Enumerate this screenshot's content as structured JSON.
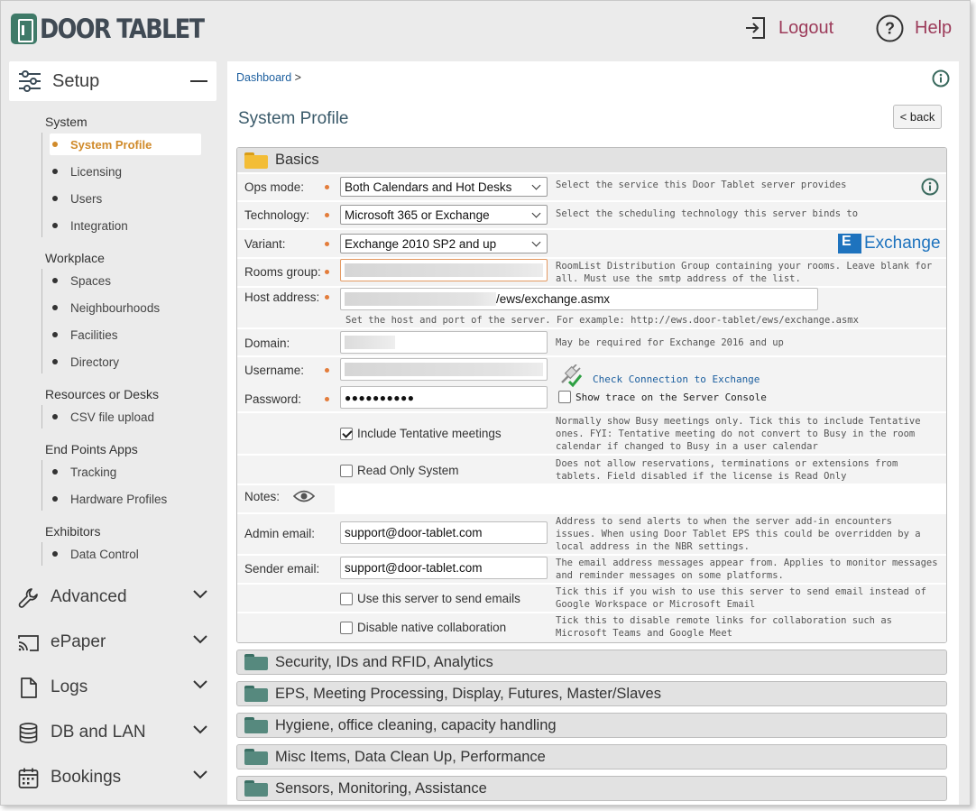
{
  "brand": {
    "logo_text": "DOOR TABLET"
  },
  "header": {
    "logout_label": "Logout",
    "help_label": "Help"
  },
  "sidebar": {
    "setup_label": "Setup",
    "groups": [
      {
        "title": "System",
        "items": [
          "System Profile",
          "Licensing",
          "Users",
          "Integration"
        ]
      },
      {
        "title": "Workplace",
        "items": [
          "Spaces",
          "Neighbourhoods",
          "Facilities",
          "Directory"
        ]
      },
      {
        "title": "Resources or Desks",
        "items": [
          "CSV file upload"
        ]
      },
      {
        "title": "End Points Apps",
        "items": [
          "Tracking",
          "Hardware Profiles"
        ]
      },
      {
        "title": "Exhibitors",
        "items": [
          "Data Control"
        ]
      }
    ],
    "active_item": "System Profile",
    "sections": [
      "Advanced",
      "ePaper",
      "Logs",
      "DB and LAN",
      "Bookings"
    ]
  },
  "main": {
    "breadcrumb": "Dashboard",
    "breadcrumb_sep": ">",
    "page_title": "System Profile",
    "back_label": "< back",
    "basics": {
      "title": "Basics",
      "ops_mode": {
        "label": "Ops mode:",
        "value": "Both Calendars and Hot Desks",
        "desc": "Select the service this Door Tablet server provides"
      },
      "technology": {
        "label": "Technology:",
        "value": "Microsoft 365 or Exchange",
        "desc": "Select the scheduling technology this server binds to"
      },
      "variant": {
        "label": "Variant:",
        "value": "Exchange 2010 SP2 and up",
        "brand": "Exchange"
      },
      "rooms_group": {
        "label": "Rooms group:",
        "desc1": "RoomList Distribution Group containing your rooms. Leave blank for",
        "desc2": "all.  Must use the smtp address of the list."
      },
      "host_address": {
        "label": "Host address:",
        "value_suffix": "/ews/exchange.asmx",
        "desc": "Set the host and port of the server. For example: http://ews.door-tablet/ews/exchange.asmx"
      },
      "domain": {
        "label": "Domain:",
        "desc": "May be required for Exchange 2016 and up"
      },
      "username": {
        "label": "Username:",
        "check_link": "Check Connection to Exchange"
      },
      "password": {
        "label": "Password:",
        "value": "●●●●●●●●●●",
        "trace_label": "Show trace on the Server Console"
      },
      "tentative": {
        "label": "Include Tentative meetings",
        "checked": true,
        "desc1": "Normally show Busy meetings only. Tick this to include Tentative",
        "desc2": "ones. FYI: Tentative meeting do not convert to Busy in the room",
        "desc3": "calendar if changed to Busy in a user calendar"
      },
      "read_only": {
        "label": "Read Only System",
        "checked": false,
        "desc1": "Does not allow reservations, terminations or extensions from",
        "desc2": "tablets. Field disabled if the license is Read Only"
      },
      "notes": {
        "label": "Notes:"
      },
      "admin_email": {
        "label": "Admin email:",
        "value": "support@door-tablet.com",
        "desc1": "Address to send alerts to when the server add-in encounters",
        "desc2": "issues.  When using Door Tablet EPS this could be overridden by a",
        "desc3": "local address in the NBR settings."
      },
      "sender_email": {
        "label": "Sender email:",
        "value": "support@door-tablet.com",
        "desc1": "The email address messages appear from. Applies to monitor messages",
        "desc2": "and reminder messages on some platforms."
      },
      "send_emails": {
        "label": "Use this server to send emails",
        "checked": false,
        "desc1": "Tick this if you wish to use this server to send email instead of",
        "desc2": "Google Workspace or Microsoft Email"
      },
      "native_collab": {
        "label": "Disable native collaboration",
        "checked": false,
        "desc1": "Tick this to disable remote links for collaboration such as",
        "desc2": "Microsoft Teams and Google Meet"
      }
    },
    "collapsed_sections": [
      "Security, IDs and RFID, Analytics",
      "EPS, Meeting Processing, Display, Futures, Master/Slaves",
      "Hygiene, office cleaning, capacity handling",
      "Misc Items, Data Clean Up, Performance",
      "Sensors, Monitoring, Assistance"
    ]
  },
  "colors": {
    "accent_active": "#d08a2a",
    "brand_teal": "#3f7a68",
    "link": "#1b5e9e",
    "header_link": "#9c3b5a",
    "required_dot": "#e37c3a"
  }
}
